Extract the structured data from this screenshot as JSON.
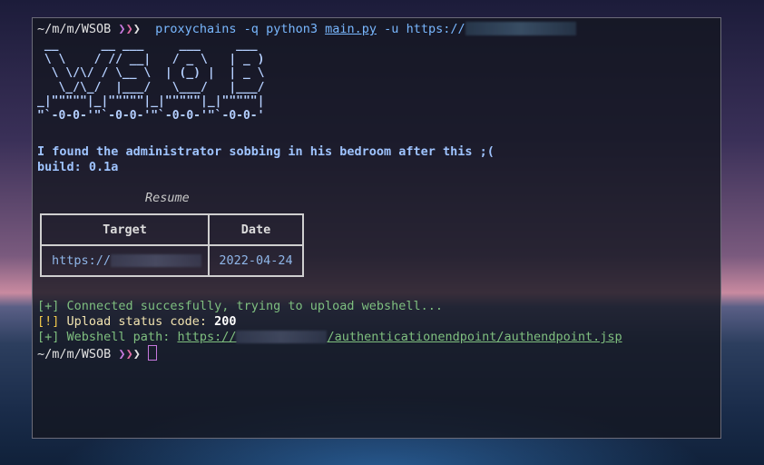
{
  "colors": {
    "terminal_bg": "#14161f",
    "prompt_arrow_1": "#c678dd",
    "prompt_arrow_2": "#e06ca6",
    "command": "#79b8ff",
    "success": "#7fbf7f",
    "warning": "#f2c94c"
  },
  "prompt1": {
    "path": "~/m/m/WSOB",
    "arrows": "❯❯❯",
    "command": "proxychains",
    "flag_q": "-q",
    "interpreter": "python3",
    "script": "main.py",
    "flag_u": "-u",
    "url_prefix": "https://"
  },
  "banner_ascii": " __      __ ___     ___     ___\n \\ \\    / // __|   / _ \\   | _ )\n  \\ \\/\\/ / \\__ \\  | (_) |  | _ \\\n   \\_/\\_/  |___/   \\___/   |___/\n_|\"\"\"\"\"|_|\"\"\"\"\"|_|\"\"\"\"\"|_|\"\"\"\"\"|\n\"`-0-0-'\"`-0-0-'\"`-0-0-'\"`-0-0-'",
  "tagline": "I found the administrator sobbing in his bedroom after this ;(",
  "build": "build: 0.1a",
  "resume": {
    "caption": "Resume",
    "headers": [
      "Target",
      "Date"
    ],
    "row": {
      "target_prefix": "https://",
      "date": "2022-04-24"
    }
  },
  "log": [
    {
      "tag": "[+]",
      "text": "Connected succesfully, trying to upload webshell..."
    },
    {
      "tag": "[!]",
      "text": "Upload status code: ",
      "value": "200"
    },
    {
      "tag": "[+]",
      "text": "Webshell path: ",
      "url_prefix": "https://",
      "url_suffix": "/authenticationendpoint/authendpoint.jsp"
    }
  ],
  "prompt2": {
    "path": "~/m/m/WSOB",
    "arrows": "❯❯❯"
  }
}
